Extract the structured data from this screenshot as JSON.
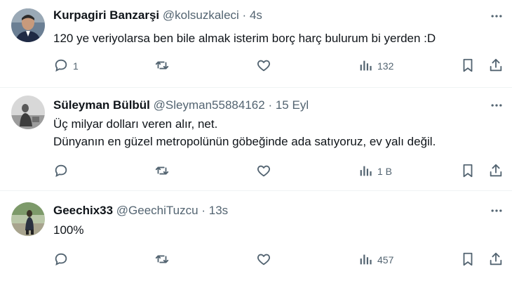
{
  "tweets": [
    {
      "name": "Kurpagiri Banzarşi",
      "handle": "@kolsuzkaleci",
      "sep": "·",
      "time": "4s",
      "lines": [
        "120 ye veriyolarsa ben bile almak isterim borç harç bulurum bi yerden :D"
      ],
      "replies": "1",
      "views": "132"
    },
    {
      "name": "Süleyman Bülbül",
      "handle": "@Sleyman55884162",
      "sep": "·",
      "time": "15 Eyl",
      "lines": [
        "Üç milyar dolları veren alır, net.",
        "Dünyanın en güzel metropolünün göbeğinde ada satıyoruz, ev yalı değil."
      ],
      "replies": "",
      "views": "1 B"
    },
    {
      "name": "Geechix33",
      "handle": "@GeechiTuzcu",
      "sep": "·",
      "time": "13s",
      "lines": [
        "100%"
      ],
      "replies": "",
      "views": "457"
    }
  ],
  "icons": {
    "more": "more-icon",
    "reply": "reply-icon",
    "retweet": "retweet-icon",
    "like": "heart-icon",
    "views": "views-icon",
    "bookmark": "bookmark-icon",
    "share": "share-icon"
  },
  "colors": {
    "text": "#0f1419",
    "secondary": "#536471",
    "divider": "#eff3f4"
  }
}
